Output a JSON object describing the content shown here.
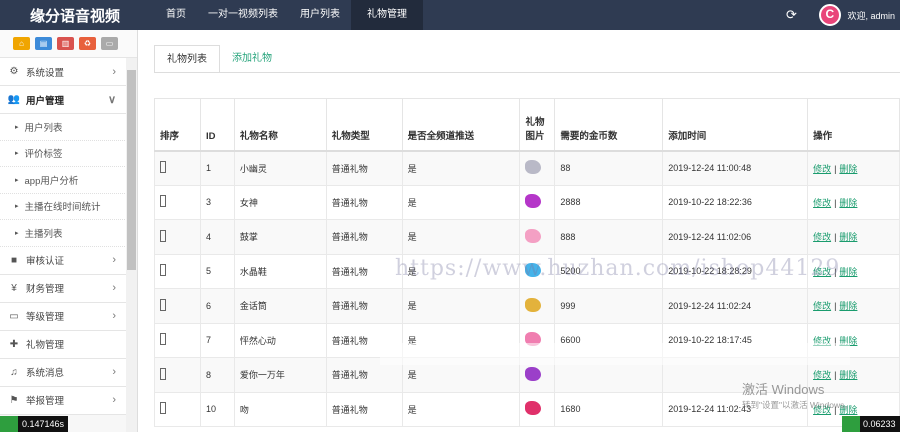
{
  "app": {
    "brand": "缘分语音视频",
    "welcome": "欢迎, admin"
  },
  "topnav": [
    "首页",
    "一对一视频列表",
    "用户列表",
    "礼物管理"
  ],
  "sidebar": {
    "shortcuts": [
      {
        "icon": "home-icon",
        "color": "#f0a500"
      },
      {
        "icon": "document-icon",
        "color": "#3d8bd9"
      },
      {
        "icon": "trash-icon",
        "color": "#d9534f"
      },
      {
        "icon": "recycle-icon",
        "color": "#e8603c"
      },
      {
        "icon": "card-icon",
        "color": "#aaaaaa"
      }
    ],
    "items": [
      {
        "label": "系统设置",
        "icon": "gears-icon",
        "chevron": "›"
      },
      {
        "label": "用户管理",
        "icon": "users-icon",
        "chevron": "∨",
        "open": true,
        "children": [
          "用户列表",
          "评价标签",
          "app用户分析",
          "主播在线时间统计",
          "主播列表"
        ]
      },
      {
        "label": "审核认证",
        "icon": "video-icon",
        "chevron": "›"
      },
      {
        "label": "财务管理",
        "icon": "yen-icon",
        "chevron": "›"
      },
      {
        "label": "等级管理",
        "icon": "monitor-icon",
        "chevron": "›"
      },
      {
        "label": "礼物管理",
        "icon": "gift-icon",
        "chevron": ""
      },
      {
        "label": "系统消息",
        "icon": "bell-icon",
        "chevron": "›"
      },
      {
        "label": "举报管理",
        "icon": "flag-icon",
        "chevron": "›"
      }
    ]
  },
  "tabs": {
    "list": "礼物列表",
    "add": "添加礼物"
  },
  "table": {
    "headers": [
      "排序",
      "ID",
      "礼物名称",
      "礼物类型",
      "是否全频道推送",
      "礼物图片",
      "需要的金币数",
      "添加时间",
      "操作"
    ],
    "edit_label": "修改",
    "delete_label": "删除",
    "separator": "|",
    "rows": [
      {
        "sort": "",
        "id": "1",
        "name": "小幽灵",
        "type": "普通礼物",
        "push": "是",
        "gift_color": "#b9b9c7",
        "coins": "88",
        "time": "2019-12-24 11:00:48"
      },
      {
        "sort": "",
        "id": "3",
        "name": "女神",
        "type": "普通礼物",
        "push": "是",
        "gift_color": "#b536c9",
        "coins": "2888",
        "time": "2019-10-22 18:22:36"
      },
      {
        "sort": "",
        "id": "4",
        "name": "鼓掌",
        "type": "普通礼物",
        "push": "是",
        "gift_color": "#f4a0c4",
        "coins": "888",
        "time": "2019-12-24 11:02:06"
      },
      {
        "sort": "",
        "id": "5",
        "name": "水晶鞋",
        "type": "普通礼物",
        "push": "是",
        "gift_color": "#45b3ea",
        "coins": "5200",
        "time": "2019-10-22 18:28:29"
      },
      {
        "sort": "",
        "id": "6",
        "name": "金话筒",
        "type": "普通礼物",
        "push": "是",
        "gift_color": "#e3b23c",
        "coins": "999",
        "time": "2019-12-24 11:02:24"
      },
      {
        "sort": "",
        "id": "7",
        "name": "怦然心动",
        "type": "普通礼物",
        "push": "是",
        "gift_color": "#f07eb0",
        "coins": "6600",
        "time": "2019-10-22 18:17:45"
      },
      {
        "sort": "",
        "id": "8",
        "name": "爱你一万年",
        "type": "普通礼物",
        "push": "是",
        "gift_color": "#9b3fc9",
        "coins": "",
        "time": ""
      },
      {
        "sort": "",
        "id": "10",
        "name": "吻",
        "type": "普通礼物",
        "push": "是",
        "gift_color": "#e0306a",
        "coins": "1680",
        "time": "2019-12-24 11:02:43"
      }
    ]
  },
  "overlays": {
    "watermark": "https://www.huzhan.com/ishop44129",
    "activate_line1": "激活 Windows",
    "activate_line2": "转到\"设置\"以激活 Windows。",
    "left_badge": "0.147146s",
    "right_badge": "0.06233"
  }
}
